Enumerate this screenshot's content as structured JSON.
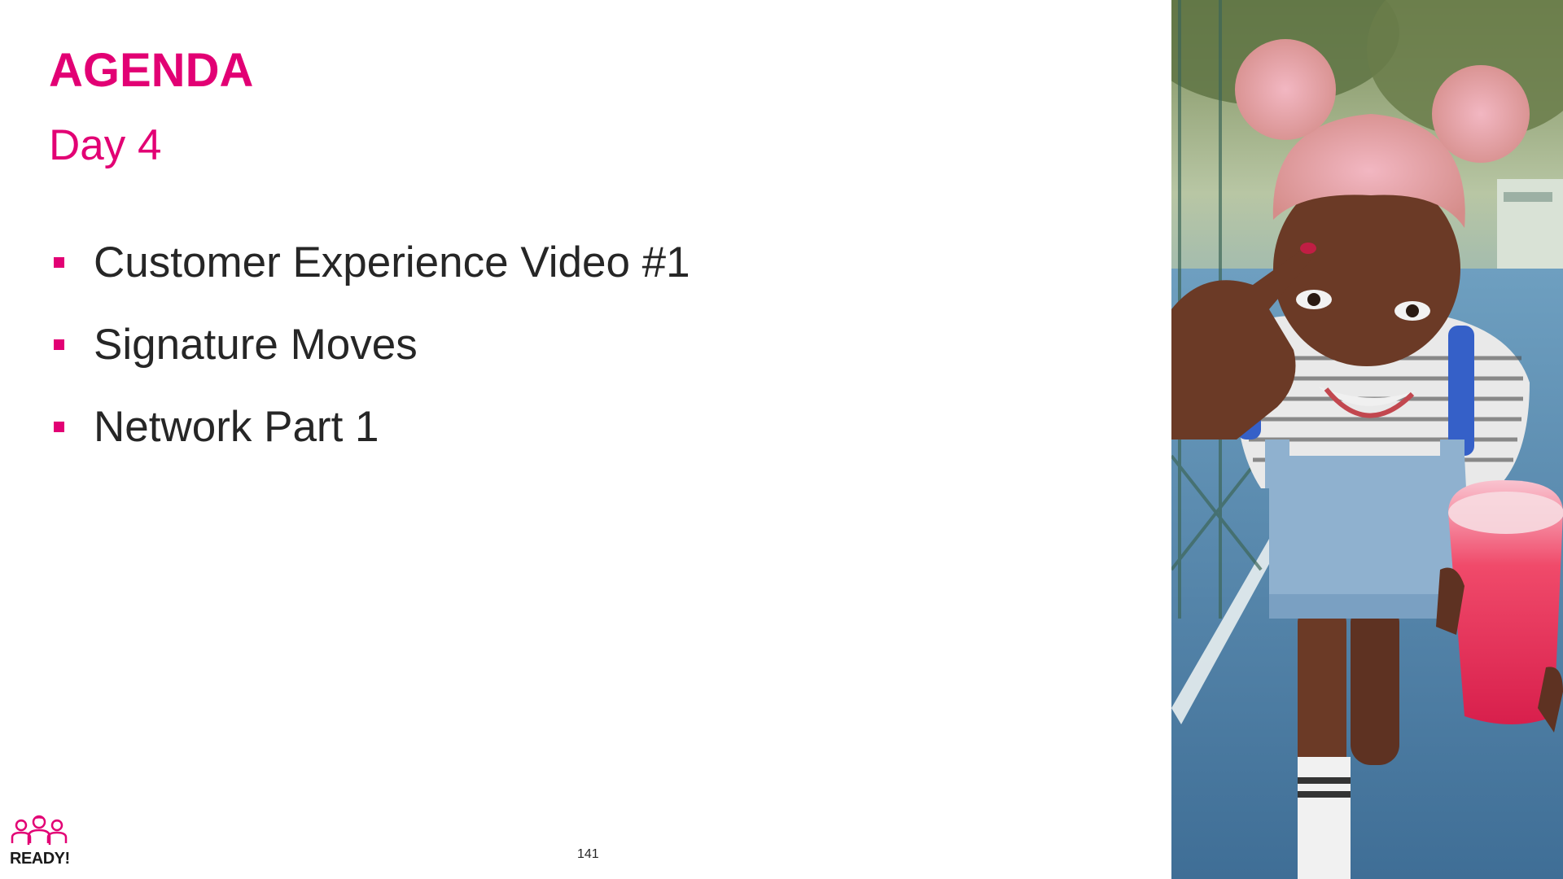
{
  "slide": {
    "title": "AGENDA",
    "subtitle": "Day 4",
    "items": [
      {
        "label": "Customer Experience Video #1"
      },
      {
        "label": "Signature Moves"
      },
      {
        "label": "Network Part 1"
      }
    ],
    "page_number": "141"
  },
  "logo": {
    "text": "READY!"
  },
  "photo": {
    "subject": "girl with pink hair holding a pink drink on a sports court"
  },
  "colors": {
    "accent": "#e20074",
    "body_text": "#262626"
  }
}
